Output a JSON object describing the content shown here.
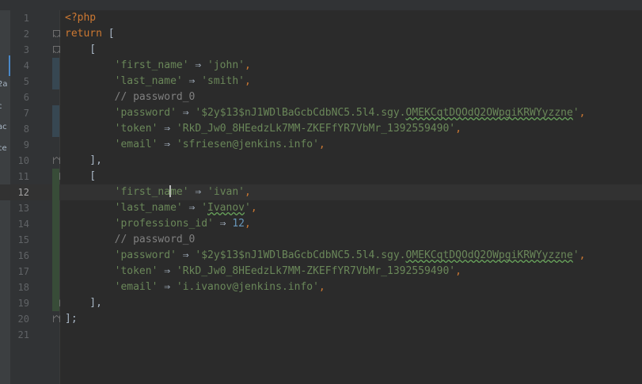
{
  "editor": {
    "current_line": 12,
    "left_panel_fragments": [
      "2a",
      "c",
      "ac",
      "ce"
    ],
    "colors": {
      "background": "#2b2b2b",
      "keyword": "#cc7832",
      "string": "#6a8759",
      "number": "#6897bb",
      "comment": "#808080",
      "text": "#a9b7c6"
    },
    "lines": [
      {
        "n": "1",
        "parts": [
          {
            "t": "<?php",
            "c": "kw"
          }
        ]
      },
      {
        "n": "2",
        "parts": [
          {
            "t": "return",
            "c": "kw"
          },
          {
            "t": " [",
            "c": "pun"
          }
        ]
      },
      {
        "n": "3",
        "parts": [
          {
            "t": "    [",
            "c": "pun"
          }
        ]
      },
      {
        "n": "4",
        "parts": [
          {
            "t": "        ",
            "c": "pun"
          },
          {
            "t": "'first_name'",
            "c": "str"
          },
          {
            "t": " ⇒ ",
            "c": "pun"
          },
          {
            "t": "'john'",
            "c": "str"
          },
          {
            "t": ",",
            "c": "kw"
          }
        ]
      },
      {
        "n": "5",
        "parts": [
          {
            "t": "        ",
            "c": "pun"
          },
          {
            "t": "'last_name'",
            "c": "str"
          },
          {
            "t": " ⇒ ",
            "c": "pun"
          },
          {
            "t": "'smith'",
            "c": "str"
          },
          {
            "t": ",",
            "c": "kw"
          }
        ]
      },
      {
        "n": "6",
        "parts": [
          {
            "t": "        ",
            "c": "pun"
          },
          {
            "t": "// password_0",
            "c": "cmt"
          }
        ]
      },
      {
        "n": "7",
        "parts": [
          {
            "t": "        ",
            "c": "pun"
          },
          {
            "t": "'password'",
            "c": "str"
          },
          {
            "t": " ⇒ ",
            "c": "pun"
          },
          {
            "t": "'$2y$13$nJ1WDlBaGcbCdbNC5.5l4.sgy.",
            "c": "str"
          },
          {
            "t": "OMEKCqtDQOdQ2OWpgiKRWYyzzne",
            "c": "str typo"
          },
          {
            "t": "'",
            "c": "str"
          },
          {
            "t": ",",
            "c": "kw"
          }
        ]
      },
      {
        "n": "8",
        "parts": [
          {
            "t": "        ",
            "c": "pun"
          },
          {
            "t": "'token'",
            "c": "str"
          },
          {
            "t": " ⇒ ",
            "c": "pun"
          },
          {
            "t": "'RkD_Jw0_8HEedzLk7MM-ZKEFfYR7VbMr_1392559490'",
            "c": "str"
          },
          {
            "t": ",",
            "c": "kw"
          }
        ]
      },
      {
        "n": "9",
        "parts": [
          {
            "t": "        ",
            "c": "pun"
          },
          {
            "t": "'email'",
            "c": "str"
          },
          {
            "t": " ⇒ ",
            "c": "pun"
          },
          {
            "t": "'sfriesen@jenkins.info'",
            "c": "str"
          },
          {
            "t": ",",
            "c": "kw"
          }
        ]
      },
      {
        "n": "10",
        "parts": [
          {
            "t": "    ],",
            "c": "pun"
          }
        ]
      },
      {
        "n": "11",
        "parts": [
          {
            "t": "    [",
            "c": "pun"
          }
        ]
      },
      {
        "n": "12",
        "parts": [
          {
            "t": "        ",
            "c": "pun"
          },
          {
            "t": "'first_na",
            "c": "str"
          },
          {
            "t": "",
            "c": "cursor"
          },
          {
            "t": "me'",
            "c": "str"
          },
          {
            "t": " ⇒ ",
            "c": "pun"
          },
          {
            "t": "'ivan'",
            "c": "str"
          },
          {
            "t": ",",
            "c": "kw"
          }
        ]
      },
      {
        "n": "13",
        "parts": [
          {
            "t": "        ",
            "c": "pun"
          },
          {
            "t": "'last_name'",
            "c": "str"
          },
          {
            "t": " ⇒ ",
            "c": "pun"
          },
          {
            "t": "'",
            "c": "str"
          },
          {
            "t": "Ivanov",
            "c": "str typo"
          },
          {
            "t": "'",
            "c": "str"
          },
          {
            "t": ",",
            "c": "kw"
          }
        ]
      },
      {
        "n": "14",
        "parts": [
          {
            "t": "        ",
            "c": "pun"
          },
          {
            "t": "'professions_id'",
            "c": "str"
          },
          {
            "t": " ⇒ ",
            "c": "pun"
          },
          {
            "t": "12",
            "c": "num"
          },
          {
            "t": ",",
            "c": "kw"
          }
        ]
      },
      {
        "n": "15",
        "parts": [
          {
            "t": "        ",
            "c": "pun"
          },
          {
            "t": "// password_0",
            "c": "cmt"
          }
        ]
      },
      {
        "n": "16",
        "parts": [
          {
            "t": "        ",
            "c": "pun"
          },
          {
            "t": "'password'",
            "c": "str"
          },
          {
            "t": " ⇒ ",
            "c": "pun"
          },
          {
            "t": "'$2y$13$nJ1WDlBaGcbCdbNC5.5l4.sgy.",
            "c": "str"
          },
          {
            "t": "OMEKCqtDQOdQ2OWpgiKRWYyzzne",
            "c": "str typo"
          },
          {
            "t": "'",
            "c": "str"
          },
          {
            "t": ",",
            "c": "kw"
          }
        ]
      },
      {
        "n": "17",
        "parts": [
          {
            "t": "        ",
            "c": "pun"
          },
          {
            "t": "'token'",
            "c": "str"
          },
          {
            "t": " ⇒ ",
            "c": "pun"
          },
          {
            "t": "'RkD_Jw0_8HEedzLk7MM-ZKEFfYR7VbMr_1392559490'",
            "c": "str"
          },
          {
            "t": ",",
            "c": "kw"
          }
        ]
      },
      {
        "n": "18",
        "parts": [
          {
            "t": "        ",
            "c": "pun"
          },
          {
            "t": "'email'",
            "c": "str"
          },
          {
            "t": " ⇒ ",
            "c": "pun"
          },
          {
            "t": "'i.ivanov@jenkins.info'",
            "c": "str"
          },
          {
            "t": ",",
            "c": "kw"
          }
        ]
      },
      {
        "n": "19",
        "parts": [
          {
            "t": "    ],",
            "c": "pun"
          }
        ]
      },
      {
        "n": "20",
        "parts": [
          {
            "t": "];",
            "c": "pun"
          }
        ]
      },
      {
        "n": "21",
        "parts": []
      }
    ]
  }
}
